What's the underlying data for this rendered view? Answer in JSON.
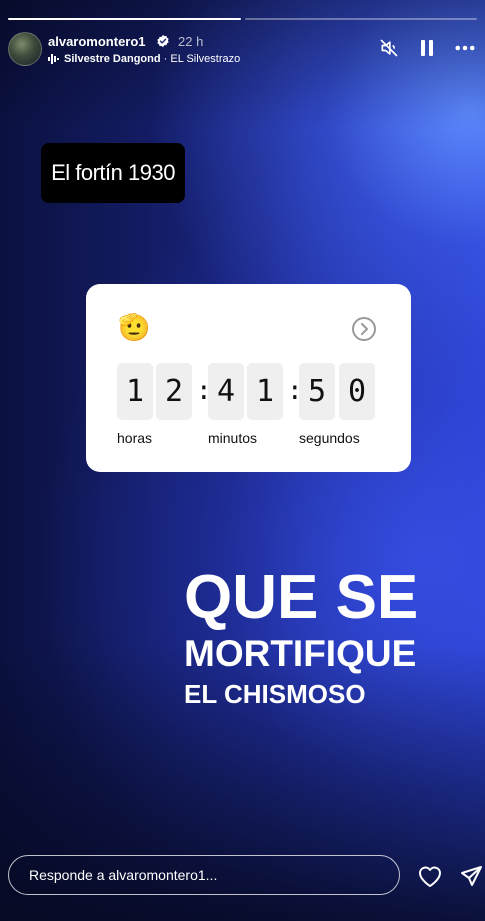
{
  "story": {
    "progress": [
      1,
      0
    ],
    "header": {
      "username": "alvaromontero1",
      "time": "22 h",
      "music_artist": "Silvestre Dangond",
      "music_separator": " · ",
      "music_song": "EL Silvestrazo"
    }
  },
  "sticker": {
    "label": "El fortín 1930"
  },
  "countdown": {
    "emoji": "🫡",
    "digits": [
      "1",
      "2",
      "4",
      "1",
      "5",
      "0"
    ],
    "colon": ":",
    "units": [
      "horas",
      "minutos",
      "segundos"
    ]
  },
  "overlay_text": {
    "line1": "QUE SE",
    "line2": "MORTIFIQUE",
    "line3": "EL CHISMOSO"
  },
  "reply": {
    "placeholder": "Responde a alvaromontero1..."
  },
  "icons": {
    "verified": "verified-badge-icon",
    "mute": "muted-speaker-icon",
    "pause": "pause-icon",
    "more": "more-dots-icon",
    "heart": "heart-icon",
    "send": "send-icon",
    "arrow": "chevron-right-icon"
  }
}
